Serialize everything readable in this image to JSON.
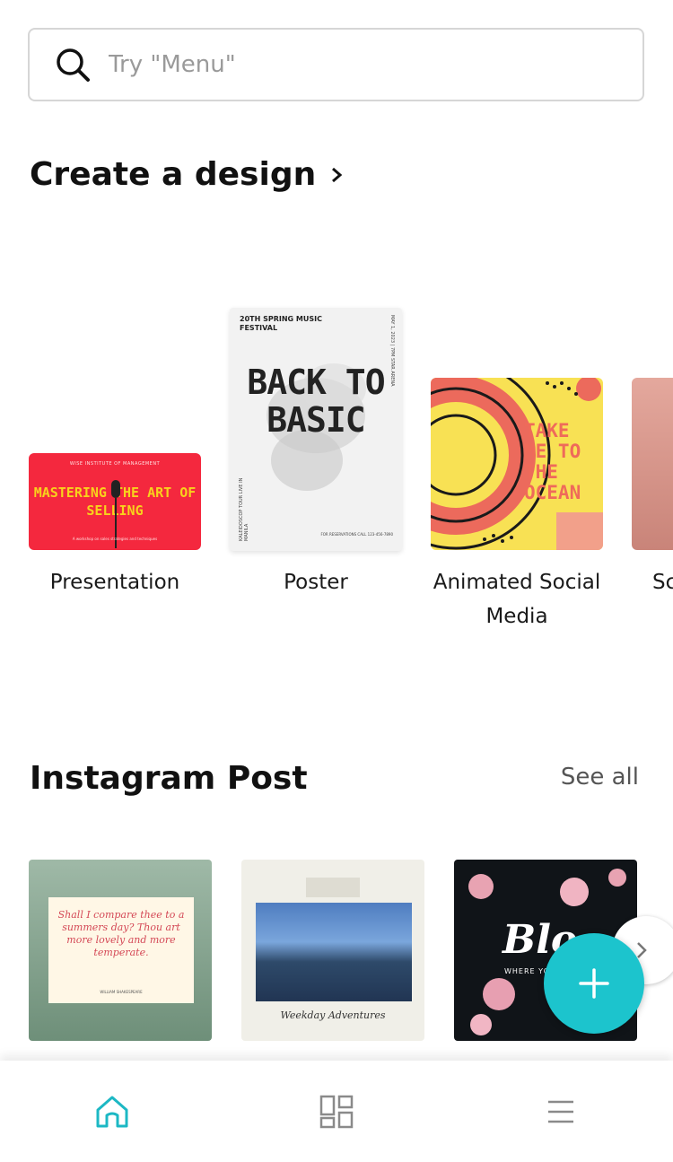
{
  "search": {
    "placeholder": "Try \"Menu\""
  },
  "create_section": {
    "title": "Create a design",
    "items": [
      {
        "label": "Presentation",
        "thumb": {
          "top": "WISE INSTITUTE OF MANAGEMENT",
          "headline": "MASTERING THE ART OF SELLING",
          "bottom": "A workshop on sales strategies and techniques"
        }
      },
      {
        "label": "Poster",
        "thumb": {
          "header": "20TH SPRING MUSIC FESTIVAL",
          "headline": "BACK TO BASIC",
          "side": "KALEIDOSCOP TOUR LIVE IN MANILA",
          "side2": "MAY 1, 2023 | 7PM STAR ARENA",
          "footer": "FOR RESERVATIONS CALL 123-456-7890"
        }
      },
      {
        "label": "Animated Social Media",
        "thumb": {
          "headline": "TAKE ME TO THE OCEAN"
        }
      },
      {
        "label": "Sc"
      }
    ]
  },
  "instagram_section": {
    "title": "Instagram Post",
    "see_all": "See all",
    "items": [
      {
        "quote": "Shall I compare thee to a summers day? Thou art more lovely and more temperate.",
        "author": "WILLIAM SHAKESPEARE"
      },
      {
        "caption": "Weekday Adventures"
      },
      {
        "word": "Blo",
        "sub": "WHERE YOU"
      }
    ]
  },
  "colors": {
    "accent": "#1cc4cd",
    "nav_active": "#1cb8c4",
    "nav_inactive": "#8a8a8a"
  },
  "icons": [
    "search-icon",
    "chevron-right-icon",
    "plus-icon",
    "home-icon",
    "grid-icon",
    "menu-icon"
  ]
}
